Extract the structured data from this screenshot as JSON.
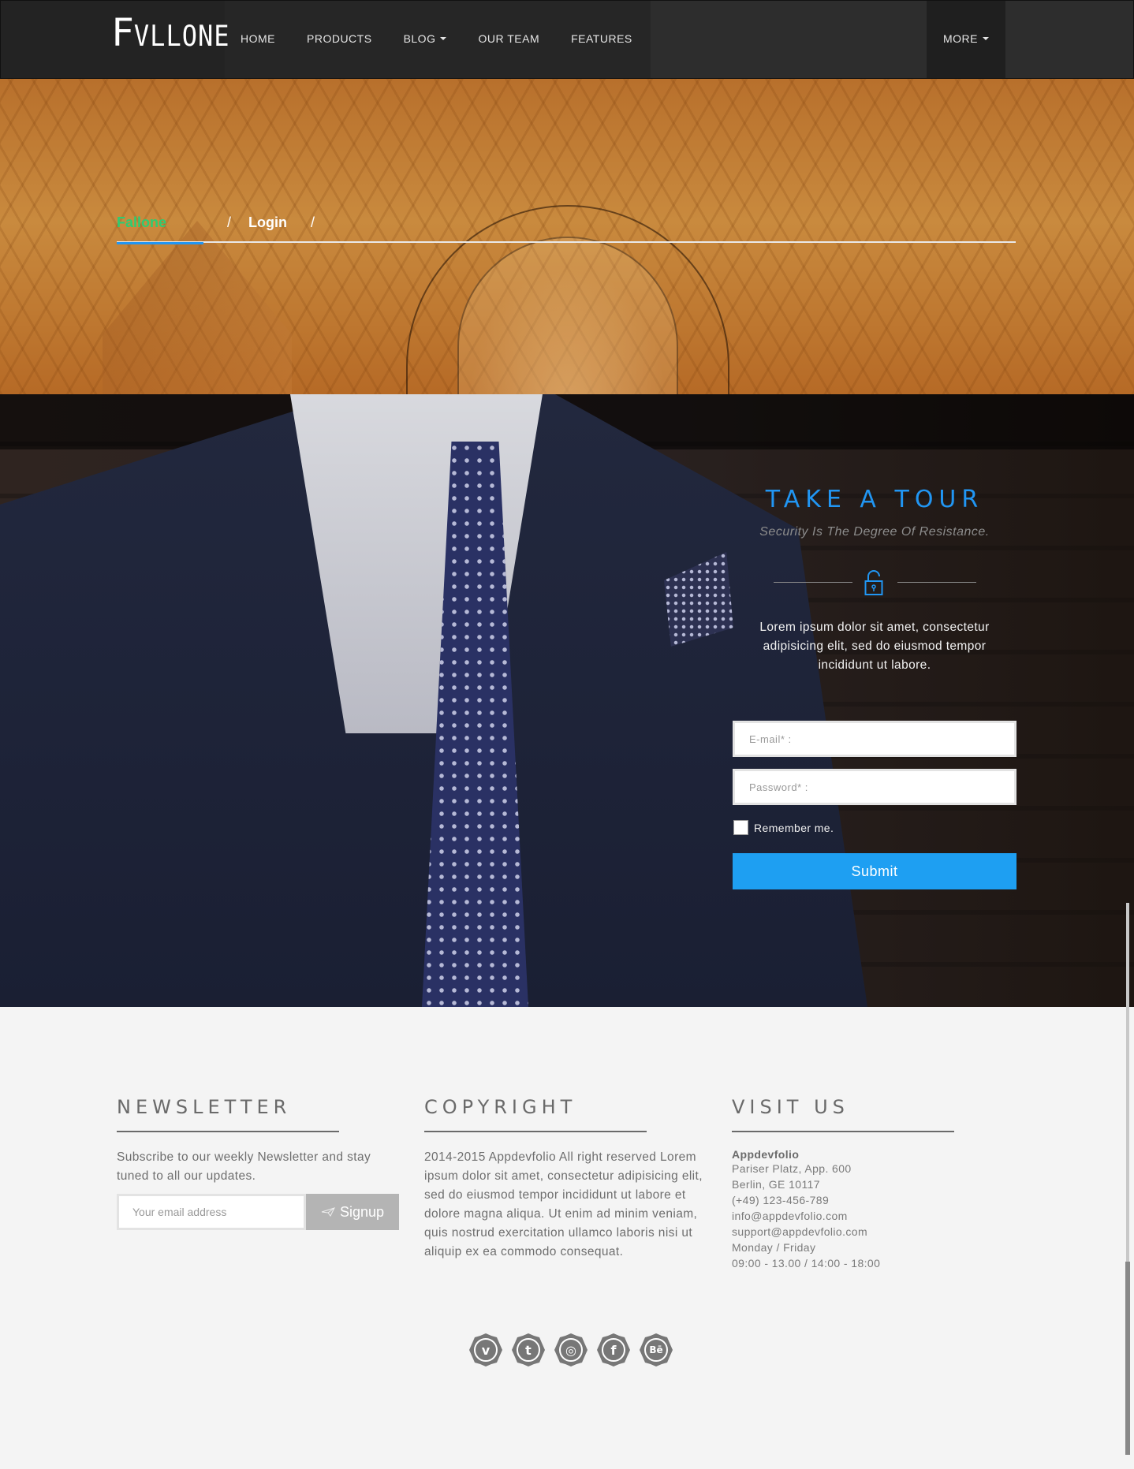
{
  "navbar": {
    "logo_first": "F",
    "logo_rest": "VLLONE",
    "links": [
      {
        "label": "HOME",
        "dropdown": false
      },
      {
        "label": "PRODUCTS",
        "dropdown": false
      },
      {
        "label": "BLOG",
        "dropdown": true
      },
      {
        "label": "OUR TEAM",
        "dropdown": false
      },
      {
        "label": "FEATURES",
        "dropdown": false
      }
    ],
    "more_label": "MORE"
  },
  "breadcrumb": {
    "active": "Fallone",
    "separator": "/",
    "current": "Login"
  },
  "login": {
    "title": "TAKE A TOUR",
    "subtitle": "Security Is The Degree Of Resistance.",
    "text": "Lorem ipsum dolor sit amet, consectetur adipisicing elit, sed do eiusmod tempor incididunt ut labore.",
    "email_placeholder": "E-mail* :",
    "password_placeholder": "Password* :",
    "remember_label": "Remember me.",
    "submit_label": "Submit",
    "accent_color": "#2196f3"
  },
  "footer": {
    "newsletter": {
      "heading": "NEWSLETTER",
      "text": "Subscribe to our weekly Newsletter and stay tuned to all our updates.",
      "email_placeholder": "Your email address",
      "signup_label": "Signup"
    },
    "copyright": {
      "heading": "COPYRIGHT",
      "text": "2014-2015 Appdevfolio All right reserved Lorem ipsum dolor sit amet, consectetur adipisicing elit, sed do eiusmod tempor incididunt ut labore et dolore magna aliqua. Ut enim ad minim veniam, quis nostrud exercitation ullamco laboris nisi ut aliquip ex ea commodo consequat."
    },
    "visit": {
      "heading": "VISIT US",
      "name": "Appdevfolio",
      "lines": [
        "Pariser Platz, App. 600",
        "Berlin, GE 10117",
        "(+49) 123-456-789",
        "info@appdevfolio.com",
        "support@appdevfolio.com",
        "Monday / Friday",
        "09:00 - 13.00 / 14:00 - 18:00"
      ]
    },
    "socials": [
      {
        "icon": "vimeo-icon",
        "glyph": "v"
      },
      {
        "icon": "twitter-icon",
        "glyph": "t"
      },
      {
        "icon": "instagram-icon",
        "glyph": "◎"
      },
      {
        "icon": "facebook-icon",
        "glyph": "f"
      },
      {
        "icon": "behance-icon",
        "glyph": "Bē"
      }
    ]
  }
}
